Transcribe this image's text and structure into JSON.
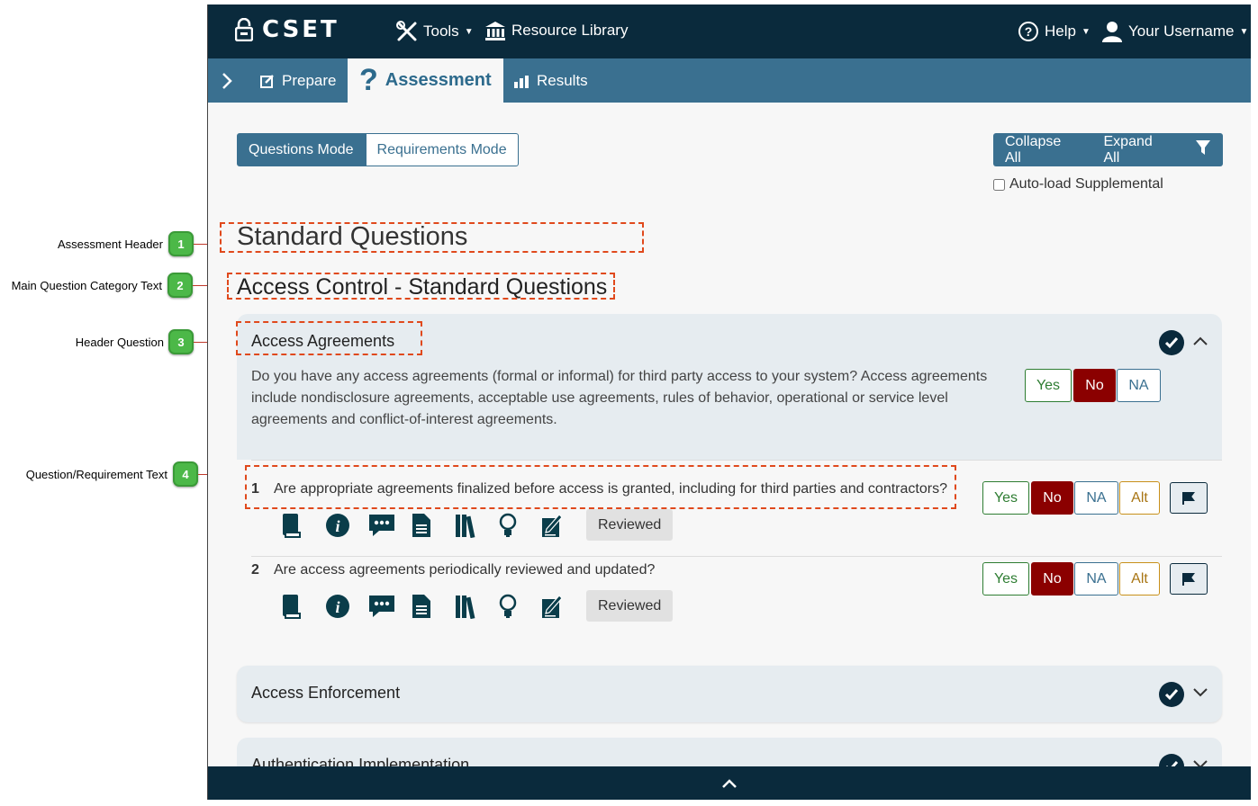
{
  "callouts": [
    {
      "num": "1",
      "label": "Assessment Header"
    },
    {
      "num": "2",
      "label": "Main Question Category Text"
    },
    {
      "num": "3",
      "label": "Header Question"
    },
    {
      "num": "4",
      "label": "Question/Requirement Text"
    }
  ],
  "topbar": {
    "logo": "CSET",
    "tools": "Tools",
    "resource_library": "Resource Library",
    "help": "Help",
    "username": "Your Username"
  },
  "nav": {
    "prepare": "Prepare",
    "assessment": "Assessment",
    "results": "Results"
  },
  "modes": {
    "questions": "Questions Mode",
    "requirements": "Requirements Mode"
  },
  "controls": {
    "collapse_all": "Collapse All",
    "expand_all": "Expand All",
    "autoload": "Auto-load Supplemental"
  },
  "headers": {
    "assessment": "Standard Questions",
    "category": "Access Control - Standard Questions"
  },
  "header_question": {
    "title": "Access Agreements",
    "text": "Do you have any access agreements (formal or informal) for third party access to your system? Access agreements include nondisclosure agreements, acceptable use agreements, rules of behavior, operational or service level agreements and conflict-of-interest agreements."
  },
  "answers": {
    "yes": "Yes",
    "no": "No",
    "na": "NA",
    "alt": "Alt"
  },
  "questions": [
    {
      "num": "1",
      "text": "Are appropriate agreements finalized before access is granted, including for third parties and contractors?",
      "reviewed": "Reviewed"
    },
    {
      "num": "2",
      "text": "Are access agreements periodically reviewed and updated?",
      "reviewed": "Reviewed"
    }
  ],
  "collapsed_panels": [
    {
      "title": "Access Enforcement"
    },
    {
      "title": "Authentication Implementation"
    }
  ],
  "colors": {
    "topbar": "#0a2a3c",
    "navbar": "#3a7090",
    "callout_badge": "#4cb848",
    "answer_no": "#8b0000"
  }
}
